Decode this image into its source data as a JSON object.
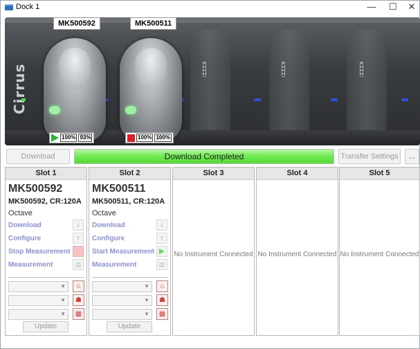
{
  "window": {
    "title": "Dock 1",
    "minimize": "—",
    "maximize": "☐",
    "close": "✕"
  },
  "dock": {
    "brand": "Cirrus",
    "devices": [
      {
        "tag": "MK500592",
        "state": "play",
        "battery": "100%",
        "memory": "93%"
      },
      {
        "tag": "MK500511",
        "state": "stop",
        "battery": "100%",
        "memory": "100%"
      }
    ]
  },
  "toolbar": {
    "download_label": "Download",
    "progress_text": "Download Completed",
    "progress_value": 1.0,
    "transfer_label": "Transfer Settings",
    "more_label": "..."
  },
  "slots": [
    {
      "header": "Slot 1",
      "serial": "MK500592",
      "subtitle": "MK500592, CR:120A",
      "model": "Octave",
      "actions": [
        "Download",
        "Configure",
        "Stop Measurement",
        "Measurement"
      ],
      "update_label": "Update"
    },
    {
      "header": "Slot 2",
      "serial": "MK500511",
      "subtitle": "MK500511, CR:120A",
      "model": "Octave",
      "actions": [
        "Download",
        "Configure",
        "Start Measurement",
        "Measurement"
      ],
      "update_label": "Update"
    },
    {
      "header": "Slot 3",
      "empty_text": "No Instrument Connected"
    },
    {
      "header": "Slot 4",
      "empty_text": "No Instrument Connected"
    },
    {
      "header": "Slot 5",
      "empty_text": "No Instrument Connected"
    }
  ],
  "colors": {
    "progress": "#6ee94f",
    "link": "#8b8fdc",
    "play": "#2cb836",
    "stop": "#d8222a"
  }
}
